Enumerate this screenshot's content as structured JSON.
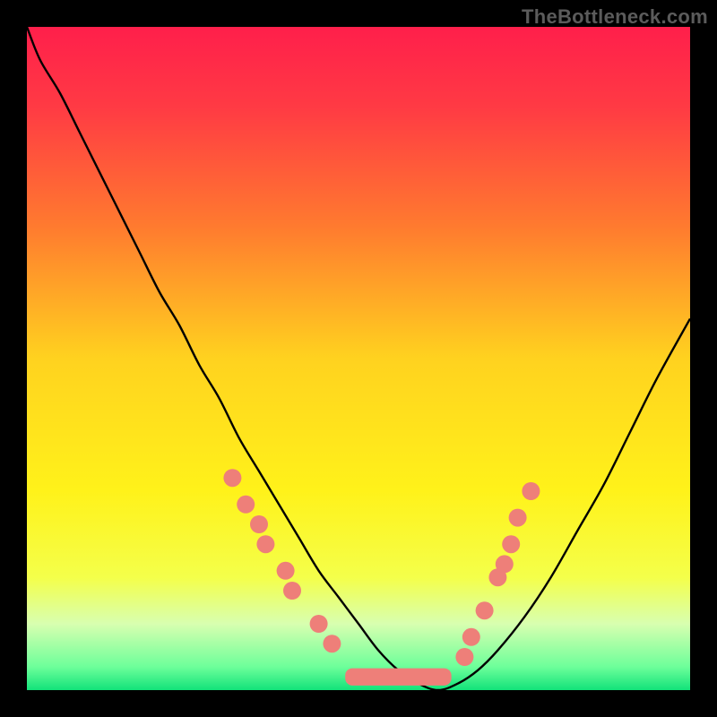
{
  "watermark": "TheBottleneck.com",
  "chart_data": {
    "type": "line",
    "title": "",
    "xlabel": "",
    "ylabel": "",
    "xlim": [
      0,
      100
    ],
    "ylim": [
      0,
      100
    ],
    "grid": false,
    "legend": false,
    "gradient_stops": [
      {
        "offset": 0.0,
        "color": "#ff1f4b"
      },
      {
        "offset": 0.12,
        "color": "#ff3a44"
      },
      {
        "offset": 0.3,
        "color": "#ff7a2f"
      },
      {
        "offset": 0.5,
        "color": "#ffd21f"
      },
      {
        "offset": 0.7,
        "color": "#fff21a"
      },
      {
        "offset": 0.83,
        "color": "#f4ff4a"
      },
      {
        "offset": 0.9,
        "color": "#d8ffb0"
      },
      {
        "offset": 0.965,
        "color": "#6dff9a"
      },
      {
        "offset": 1.0,
        "color": "#12e27a"
      }
    ],
    "series": [
      {
        "name": "bottleneck-curve",
        "color": "#000000",
        "x": [
          0,
          2,
          5,
          8,
          11,
          14,
          17,
          20,
          23,
          26,
          29,
          32,
          35,
          38,
          41,
          44,
          47,
          50,
          53,
          56,
          59,
          62,
          65,
          68,
          71,
          75,
          79,
          83,
          87,
          91,
          95,
          100
        ],
        "values": [
          100,
          95,
          90,
          84,
          78,
          72,
          66,
          60,
          55,
          49,
          44,
          38,
          33,
          28,
          23,
          18,
          14,
          10,
          6,
          3,
          1,
          0,
          1,
          3,
          6,
          11,
          17,
          24,
          31,
          39,
          47,
          56
        ]
      }
    ],
    "scatter": {
      "name": "measured-configs",
      "color": "#ee7f79",
      "radius": 10,
      "points": [
        {
          "x": 31,
          "y": 32
        },
        {
          "x": 33,
          "y": 28
        },
        {
          "x": 35,
          "y": 25
        },
        {
          "x": 36,
          "y": 22
        },
        {
          "x": 39,
          "y": 18
        },
        {
          "x": 40,
          "y": 15
        },
        {
          "x": 44,
          "y": 10
        },
        {
          "x": 46,
          "y": 7
        },
        {
          "x": 66,
          "y": 5
        },
        {
          "x": 67,
          "y": 8
        },
        {
          "x": 69,
          "y": 12
        },
        {
          "x": 71,
          "y": 17
        },
        {
          "x": 72,
          "y": 19
        },
        {
          "x": 73,
          "y": 22
        },
        {
          "x": 74,
          "y": 26
        },
        {
          "x": 76,
          "y": 30
        }
      ],
      "bar_connector": {
        "x_start": 48,
        "x_end": 64,
        "y": 2,
        "height": 2.6
      }
    }
  }
}
